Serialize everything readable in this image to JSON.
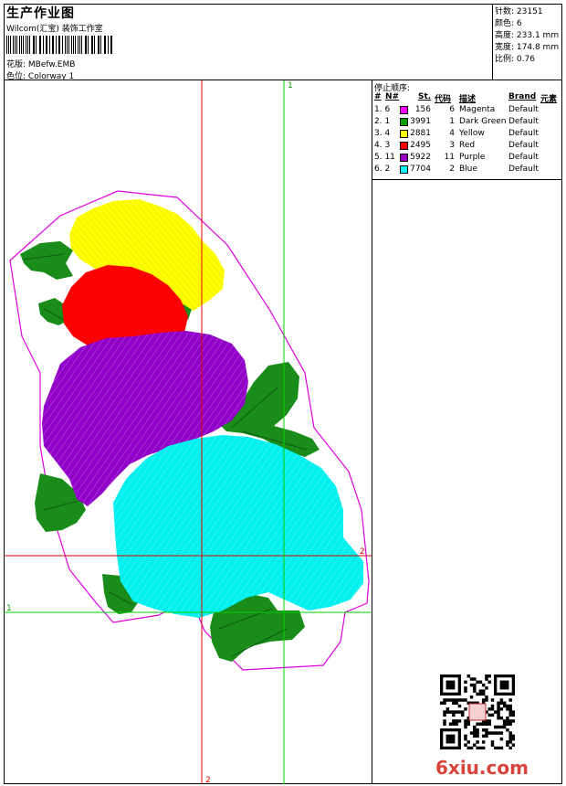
{
  "header": {
    "title": "生产作业图",
    "subtitle": "Wilcom(汇宝) 装饰工作室",
    "design_label": "花版:",
    "design_value": "MBefw.EMB",
    "colorway_label": "色位:",
    "colorway_value": "Colorway 1"
  },
  "stats": [
    {
      "label": "针数:",
      "value": "23151"
    },
    {
      "label": "颜色:",
      "value": "6"
    },
    {
      "label": "高度:",
      "value": "233.1 mm"
    },
    {
      "label": "宽度:",
      "value": "174.8 mm"
    },
    {
      "label": "比例:",
      "value": "0.76"
    }
  ],
  "stop_sequence": {
    "title": "停止顺序:",
    "columns": {
      "num": "#",
      "n": "N#",
      "st": "St.",
      "code": "代码",
      "desc": "描述",
      "brand": "Brand",
      "element": "元素"
    },
    "rows": [
      {
        "num": "1. 6",
        "st": "156",
        "code": "6",
        "desc": "Magenta",
        "brand": "Default",
        "color": "#ff00ff"
      },
      {
        "num": "2. 1",
        "st": "3991",
        "code": "1",
        "desc": "Dark Green",
        "brand": "Default",
        "color": "#00a000"
      },
      {
        "num": "3. 4",
        "st": "2881",
        "code": "4",
        "desc": "Yellow",
        "brand": "Default",
        "color": "#ffff00"
      },
      {
        "num": "4. 3",
        "st": "2495",
        "code": "3",
        "desc": "Red",
        "brand": "Default",
        "color": "#ff0000"
      },
      {
        "num": "5. 11",
        "st": "5922",
        "code": "11",
        "desc": "Purple",
        "brand": "Default",
        "color": "#9a00c8"
      },
      {
        "num": "6. 2",
        "st": "7704",
        "code": "2",
        "desc": "Blue",
        "brand": "Default",
        "color": "#00ffff"
      }
    ]
  },
  "guides": {
    "green_label": "1",
    "red_label": "2"
  },
  "colors": {
    "magenta": "#e000e0",
    "green": "#1a8c1a",
    "yellow": "#ffff00",
    "red": "#ff0000",
    "purple": "#9000c8",
    "cyan": "#00f0f0",
    "guide_red": "#e00000",
    "guide_green": "#00d000"
  },
  "watermark": "6xiu.com"
}
